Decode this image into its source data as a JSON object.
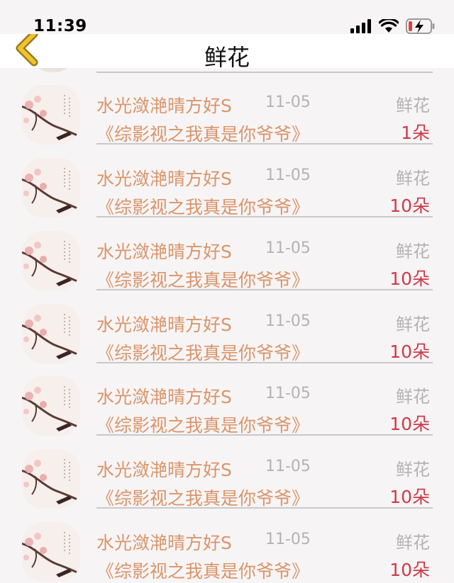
{
  "status_bar": {
    "time": "11:39",
    "icons": [
      "cellular-signal-icon",
      "wifi-icon",
      "battery-charging-icon"
    ],
    "battery_color": "#e0413a"
  },
  "nav": {
    "title": "鲜花",
    "back_icon": "chevron-left-icon",
    "back_color": "#f2c230"
  },
  "colors": {
    "name_text": "#d9956a",
    "count_text": "#cc3c4a",
    "muted_text": "#b3b3b3"
  },
  "records": [
    {
      "user": "水光潋滟晴方好S",
      "date": "11-05",
      "gift_type": "鲜花",
      "book": "《综影视之我真是你爷爷》",
      "count": "1朵"
    },
    {
      "user": "水光潋滟晴方好S",
      "date": "11-05",
      "gift_type": "鲜花",
      "book": "《综影视之我真是你爷爷》",
      "count": "10朵"
    },
    {
      "user": "水光潋滟晴方好S",
      "date": "11-05",
      "gift_type": "鲜花",
      "book": "《综影视之我真是你爷爷》",
      "count": "10朵"
    },
    {
      "user": "水光潋滟晴方好S",
      "date": "11-05",
      "gift_type": "鲜花",
      "book": "《综影视之我真是你爷爷》",
      "count": "10朵"
    },
    {
      "user": "水光潋滟晴方好S",
      "date": "11-05",
      "gift_type": "鲜花",
      "book": "《综影视之我真是你爷爷》",
      "count": "10朵"
    },
    {
      "user": "水光潋滟晴方好S",
      "date": "11-05",
      "gift_type": "鲜花",
      "book": "《综影视之我真是你爷爷》",
      "count": "10朵"
    },
    {
      "user": "水光潋滟晴方好S",
      "date": "11-05",
      "gift_type": "鲜花",
      "book": "《综影视之我真是你爷爷》",
      "count": "10朵"
    }
  ]
}
